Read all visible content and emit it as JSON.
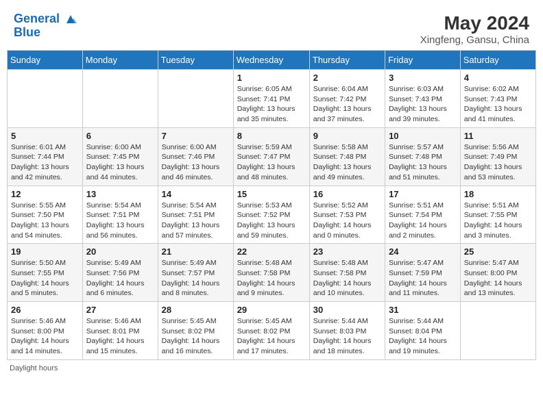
{
  "header": {
    "logo_line1": "General",
    "logo_line2": "Blue",
    "month_year": "May 2024",
    "location": "Xingfeng, Gansu, China"
  },
  "days_of_week": [
    "Sunday",
    "Monday",
    "Tuesday",
    "Wednesday",
    "Thursday",
    "Friday",
    "Saturday"
  ],
  "weeks": [
    [
      {
        "day": "",
        "info": ""
      },
      {
        "day": "",
        "info": ""
      },
      {
        "day": "",
        "info": ""
      },
      {
        "day": "1",
        "info": "Sunrise: 6:05 AM\nSunset: 7:41 PM\nDaylight: 13 hours\nand 35 minutes."
      },
      {
        "day": "2",
        "info": "Sunrise: 6:04 AM\nSunset: 7:42 PM\nDaylight: 13 hours\nand 37 minutes."
      },
      {
        "day": "3",
        "info": "Sunrise: 6:03 AM\nSunset: 7:43 PM\nDaylight: 13 hours\nand 39 minutes."
      },
      {
        "day": "4",
        "info": "Sunrise: 6:02 AM\nSunset: 7:43 PM\nDaylight: 13 hours\nand 41 minutes."
      }
    ],
    [
      {
        "day": "5",
        "info": "Sunrise: 6:01 AM\nSunset: 7:44 PM\nDaylight: 13 hours\nand 42 minutes."
      },
      {
        "day": "6",
        "info": "Sunrise: 6:00 AM\nSunset: 7:45 PM\nDaylight: 13 hours\nand 44 minutes."
      },
      {
        "day": "7",
        "info": "Sunrise: 6:00 AM\nSunset: 7:46 PM\nDaylight: 13 hours\nand 46 minutes."
      },
      {
        "day": "8",
        "info": "Sunrise: 5:59 AM\nSunset: 7:47 PM\nDaylight: 13 hours\nand 48 minutes."
      },
      {
        "day": "9",
        "info": "Sunrise: 5:58 AM\nSunset: 7:48 PM\nDaylight: 13 hours\nand 49 minutes."
      },
      {
        "day": "10",
        "info": "Sunrise: 5:57 AM\nSunset: 7:48 PM\nDaylight: 13 hours\nand 51 minutes."
      },
      {
        "day": "11",
        "info": "Sunrise: 5:56 AM\nSunset: 7:49 PM\nDaylight: 13 hours\nand 53 minutes."
      }
    ],
    [
      {
        "day": "12",
        "info": "Sunrise: 5:55 AM\nSunset: 7:50 PM\nDaylight: 13 hours\nand 54 minutes."
      },
      {
        "day": "13",
        "info": "Sunrise: 5:54 AM\nSunset: 7:51 PM\nDaylight: 13 hours\nand 56 minutes."
      },
      {
        "day": "14",
        "info": "Sunrise: 5:54 AM\nSunset: 7:51 PM\nDaylight: 13 hours\nand 57 minutes."
      },
      {
        "day": "15",
        "info": "Sunrise: 5:53 AM\nSunset: 7:52 PM\nDaylight: 13 hours\nand 59 minutes."
      },
      {
        "day": "16",
        "info": "Sunrise: 5:52 AM\nSunset: 7:53 PM\nDaylight: 14 hours\nand 0 minutes."
      },
      {
        "day": "17",
        "info": "Sunrise: 5:51 AM\nSunset: 7:54 PM\nDaylight: 14 hours\nand 2 minutes."
      },
      {
        "day": "18",
        "info": "Sunrise: 5:51 AM\nSunset: 7:55 PM\nDaylight: 14 hours\nand 3 minutes."
      }
    ],
    [
      {
        "day": "19",
        "info": "Sunrise: 5:50 AM\nSunset: 7:55 PM\nDaylight: 14 hours\nand 5 minutes."
      },
      {
        "day": "20",
        "info": "Sunrise: 5:49 AM\nSunset: 7:56 PM\nDaylight: 14 hours\nand 6 minutes."
      },
      {
        "day": "21",
        "info": "Sunrise: 5:49 AM\nSunset: 7:57 PM\nDaylight: 14 hours\nand 8 minutes."
      },
      {
        "day": "22",
        "info": "Sunrise: 5:48 AM\nSunset: 7:58 PM\nDaylight: 14 hours\nand 9 minutes."
      },
      {
        "day": "23",
        "info": "Sunrise: 5:48 AM\nSunset: 7:58 PM\nDaylight: 14 hours\nand 10 minutes."
      },
      {
        "day": "24",
        "info": "Sunrise: 5:47 AM\nSunset: 7:59 PM\nDaylight: 14 hours\nand 11 minutes."
      },
      {
        "day": "25",
        "info": "Sunrise: 5:47 AM\nSunset: 8:00 PM\nDaylight: 14 hours\nand 13 minutes."
      }
    ],
    [
      {
        "day": "26",
        "info": "Sunrise: 5:46 AM\nSunset: 8:00 PM\nDaylight: 14 hours\nand 14 minutes."
      },
      {
        "day": "27",
        "info": "Sunrise: 5:46 AM\nSunset: 8:01 PM\nDaylight: 14 hours\nand 15 minutes."
      },
      {
        "day": "28",
        "info": "Sunrise: 5:45 AM\nSunset: 8:02 PM\nDaylight: 14 hours\nand 16 minutes."
      },
      {
        "day": "29",
        "info": "Sunrise: 5:45 AM\nSunset: 8:02 PM\nDaylight: 14 hours\nand 17 minutes."
      },
      {
        "day": "30",
        "info": "Sunrise: 5:44 AM\nSunset: 8:03 PM\nDaylight: 14 hours\nand 18 minutes."
      },
      {
        "day": "31",
        "info": "Sunrise: 5:44 AM\nSunset: 8:04 PM\nDaylight: 14 hours\nand 19 minutes."
      },
      {
        "day": "",
        "info": ""
      }
    ]
  ],
  "footer": {
    "daylight_label": "Daylight hours"
  }
}
